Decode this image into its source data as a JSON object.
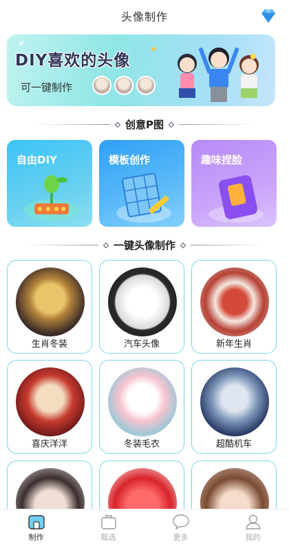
{
  "header": {
    "title": "头像制作",
    "vip_icon": "diamond-icon"
  },
  "banner": {
    "title": "DIY喜欢的头像",
    "subtitle": "可一键制作"
  },
  "sections": {
    "creative": "创意P图",
    "oneclick": "一键头像制作"
  },
  "cards": [
    {
      "label": "自由DIY",
      "icon": "plant-icon"
    },
    {
      "label": "模板创作",
      "icon": "grid-pencil-icon"
    },
    {
      "label": "趣味捏脸",
      "icon": "book-icon"
    }
  ],
  "templates": [
    {
      "label": "生肖冬装"
    },
    {
      "label": "汽车头像"
    },
    {
      "label": "新年生肖"
    },
    {
      "label": "喜庆洋洋"
    },
    {
      "label": "冬装毛衣"
    },
    {
      "label": "超酷机车"
    },
    {
      "label": ""
    },
    {
      "label": ""
    },
    {
      "label": ""
    }
  ],
  "tabbar": [
    {
      "label": "制作",
      "icon": "home-icon",
      "active": true
    },
    {
      "label": "甄选",
      "icon": "bag-icon",
      "active": false
    },
    {
      "label": "更多",
      "icon": "chat-icon",
      "active": false
    },
    {
      "label": "我的",
      "icon": "user-icon",
      "active": false
    }
  ],
  "colors": {
    "accent": "#3cc3f7",
    "border": "#7fd3e6",
    "purple": "#b78af6"
  }
}
